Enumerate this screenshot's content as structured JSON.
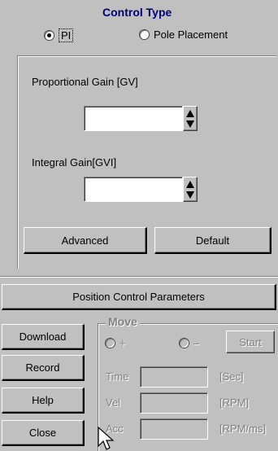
{
  "control_type": {
    "title": "Control Type",
    "options": [
      {
        "label": "PI",
        "selected": true
      },
      {
        "label": "Pole Placement",
        "selected": false
      }
    ]
  },
  "gains": {
    "proportional_label": "Proportional Gain [GV]",
    "proportional_value": "",
    "integral_label": "Integral Gain[GVI]",
    "integral_value": ""
  },
  "buttons": {
    "advanced": "Advanced",
    "default": "Default",
    "position_control": "Position Control Parameters",
    "download": "Download",
    "record": "Record",
    "help": "Help",
    "close": "Close"
  },
  "move": {
    "title": "Move",
    "plus": "+",
    "minus": "–",
    "start": "Start",
    "time_label": "Time",
    "time_unit": "[Sec]",
    "vel_label": "Vel",
    "vel_unit": "[RPM]",
    "acc_label": "Acc",
    "acc_unit": "[RPM/ms]"
  },
  "colors": {
    "face": "#c0c0c0",
    "title": "#00007b",
    "disabled_text": "#808080"
  }
}
